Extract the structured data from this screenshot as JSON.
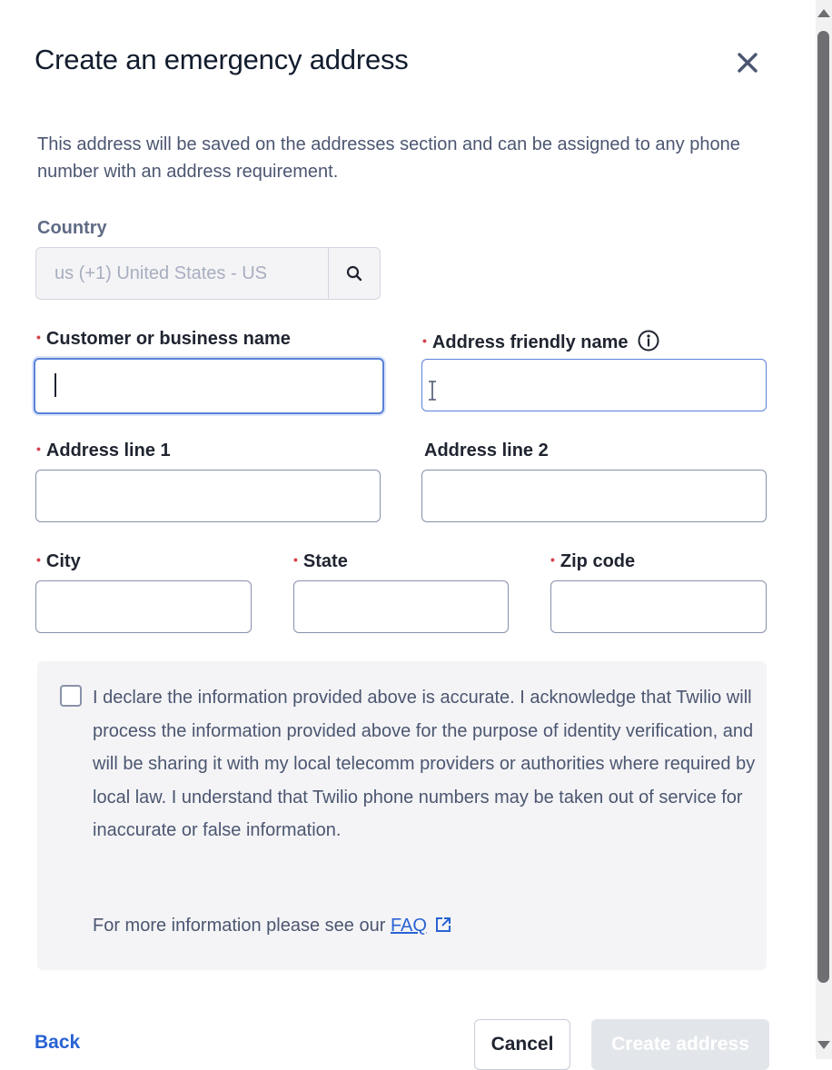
{
  "modal": {
    "title": "Create an emergency address",
    "description": "This address will be saved on the addresses section and can be assigned to any phone number with an address requirement."
  },
  "country": {
    "label": "Country",
    "value": "us  (+1) United States - US"
  },
  "fields": {
    "customer_name_label": "Customer or business name",
    "friendly_name_label": "Address friendly name",
    "address1_label": "Address line 1",
    "address2_label": "Address line 2",
    "city_label": "City",
    "state_label": "State",
    "zip_label": "Zip code",
    "customer_name_value": "",
    "friendly_name_value": "",
    "address1_value": "",
    "address2_value": "",
    "city_value": "",
    "state_value": "",
    "zip_value": ""
  },
  "declaration": {
    "text": "I declare the information provided above is accurate. I acknowledge that Twilio will process the information provided above for the purpose of identity verification, and will be sharing it with my local telecomm providers or authorities where required by local law. I understand that Twilio phone numbers may be taken out of service for inaccurate or false information.",
    "faq_prefix": "For more information please see our",
    "faq_link": "FAQ",
    "checked": false
  },
  "footer": {
    "back_label": "Back",
    "cancel_label": "Cancel",
    "create_label": "Create address"
  },
  "icons": {
    "close": "close-icon",
    "search": "search-icon",
    "info": "info-icon",
    "external": "external-link-icon"
  },
  "colors": {
    "link": "#2962d4",
    "required": "#d6424b",
    "focus": "#5a82d8"
  }
}
